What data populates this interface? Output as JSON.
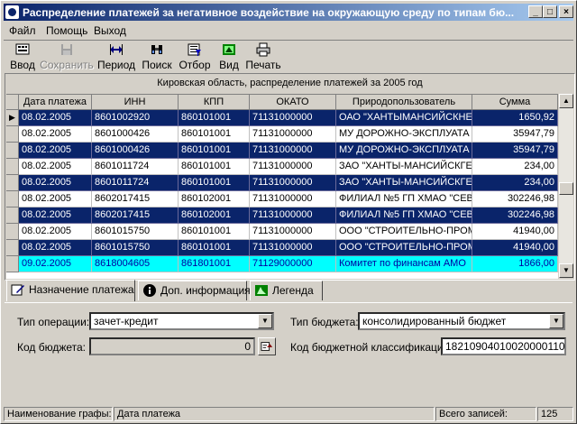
{
  "window": {
    "title": "Распределение платежей за негативное воздействие на окружающую среду по типам бю...",
    "min_glyph": "_",
    "max_glyph": "□",
    "close_glyph": "×"
  },
  "menu": [
    "Файл",
    "Помощь",
    "Выход"
  ],
  "toolbar": {
    "items": [
      {
        "label": "Ввод",
        "icon": "input-icon"
      },
      {
        "label": "Сохранить",
        "icon": "save-icon",
        "disabled": true
      },
      {
        "label": "Период",
        "icon": "period-icon"
      },
      {
        "label": "Поиск",
        "icon": "binoculars-icon"
      },
      {
        "label": "Отбор",
        "icon": "filter-icon"
      },
      {
        "label": "Вид",
        "icon": "view-icon"
      },
      {
        "label": "Печать",
        "icon": "printer-icon"
      }
    ]
  },
  "grid": {
    "caption": "Кировская область, распределение платежей за 2005 год",
    "columns": [
      "Дата платежа",
      "ИНН",
      "КПП",
      "ОКАТО",
      "Природопользователь",
      "Сумма"
    ],
    "rows": [
      {
        "date": "08.02.2005",
        "inn": "8601002920",
        "kpp": "860101001",
        "okato": "71131000000",
        "user": "ОАО \"ХАНТЫМАНСИЙСКНЕ",
        "sum": "1650,92",
        "style": "sel",
        "current": true
      },
      {
        "date": "08.02.2005",
        "inn": "8601000426",
        "kpp": "860101001",
        "okato": "71131000000",
        "user": "МУ ДОРОЖНО-ЭКСПЛУАТА",
        "sum": "35947,79",
        "style": "plain"
      },
      {
        "date": "08.02.2005",
        "inn": "8601000426",
        "kpp": "860101001",
        "okato": "71131000000",
        "user": "МУ ДОРОЖНО-ЭКСПЛУАТА",
        "sum": "35947,79",
        "style": "sel"
      },
      {
        "date": "08.02.2005",
        "inn": "8601011724",
        "kpp": "860101001",
        "okato": "71131000000",
        "user": "ЗАО \"ХАНТЫ-МАНСИЙСКГЕ",
        "sum": "234,00",
        "style": "plain"
      },
      {
        "date": "08.02.2005",
        "inn": "8601011724",
        "kpp": "860101001",
        "okato": "71131000000",
        "user": "ЗАО \"ХАНТЫ-МАНСИЙСКГЕ",
        "sum": "234,00",
        "style": "sel"
      },
      {
        "date": "08.02.2005",
        "inn": "8602017415",
        "kpp": "860102001",
        "okato": "71131000000",
        "user": "ФИЛИАЛ №5 ГП ХМАО \"СЕВ",
        "sum": "302246,98",
        "style": "plain"
      },
      {
        "date": "08.02.2005",
        "inn": "8602017415",
        "kpp": "860102001",
        "okato": "71131000000",
        "user": "ФИЛИАЛ №5 ГП ХМАО \"СЕВ",
        "sum": "302246,98",
        "style": "sel"
      },
      {
        "date": "08.02.2005",
        "inn": "8601015750",
        "kpp": "860101001",
        "okato": "71131000000",
        "user": "ООО \"СТРОИТЕЛЬНО-ПРОМ",
        "sum": "41940,00",
        "style": "plain"
      },
      {
        "date": "08.02.2005",
        "inn": "8601015750",
        "kpp": "860101001",
        "okato": "71131000000",
        "user": "ООО \"СТРОИТЕЛЬНО-ПРОМ",
        "sum": "41940,00",
        "style": "sel"
      },
      {
        "date": "09.02.2005",
        "inn": "8618004605",
        "kpp": "861801001",
        "okato": "71129000000",
        "user": "Комитет по финансам АМО",
        "sum": "1866,00",
        "style": "cyan"
      }
    ]
  },
  "tabs": [
    {
      "label": "Назначение платежа",
      "icon": "edit-icon",
      "active": true
    },
    {
      "label": "Доп. информация",
      "icon": "info-icon"
    },
    {
      "label": "Легенда",
      "icon": "legend-icon"
    }
  ],
  "form": {
    "op_type_label": "Тип операции:",
    "op_type_value": "зачет-кредит",
    "budget_type_label": "Тип бюджета:",
    "budget_type_value": "консолидированный бюджет",
    "budget_code_label": "Код бюджета:",
    "budget_code_value": "0",
    "kbk_label": "Код бюджетной классификации",
    "kbk_value": "18210904010020000110"
  },
  "status": {
    "field_label": "Наименование графы:",
    "field_value": "Дата платежа",
    "records_label": "Всего записей:",
    "records_value": "125"
  },
  "colors": {
    "title_start": "#0a246a",
    "title_end": "#a6caf0",
    "selection": "#0a246a",
    "highlight": "#00ffff"
  }
}
